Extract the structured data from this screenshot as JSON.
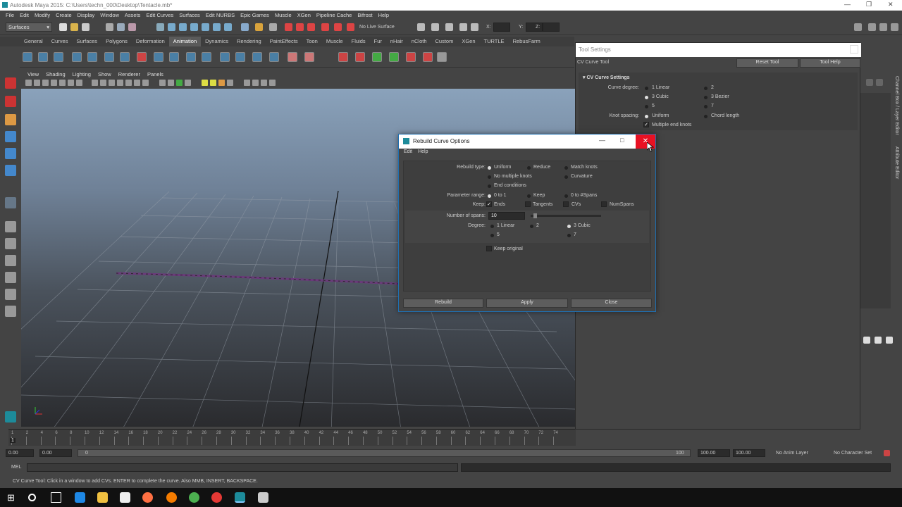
{
  "window": {
    "title": "Autodesk Maya 2015: C:\\Users\\techn_000\\Desktop\\Tentacle.mb*"
  },
  "menubar": [
    "File",
    "Edit",
    "Modify",
    "Create",
    "Display",
    "Window",
    "Assets",
    "Edit Curves",
    "Surfaces",
    "Edit NURBS",
    "Epic Games",
    "Muscle",
    "XGen",
    "Pipeline Cache",
    "Bifrost",
    "Help"
  ],
  "statusline": {
    "menuset": "Surfaces",
    "live_surface": "No Live Surface",
    "x_label": "X:",
    "y_label": "Y:",
    "z_label": "Z:"
  },
  "shelf": {
    "tabs": [
      "General",
      "Curves",
      "Surfaces",
      "Polygons",
      "Deformation",
      "Animation",
      "Dynamics",
      "Rendering",
      "PaintEffects",
      "Toon",
      "Muscle",
      "Fluids",
      "Fur",
      "nHair",
      "nCloth",
      "Custom",
      "XGen",
      "TURTLE",
      "RebusFarm"
    ],
    "active_tab": "Animation"
  },
  "viewport": {
    "menu": [
      "View",
      "Shading",
      "Lighting",
      "Show",
      "Renderer",
      "Panels"
    ]
  },
  "tool_settings": {
    "title": "Tool Settings",
    "tool_name": "CV Curve Tool",
    "reset_button": "Reset Tool",
    "help_button": "Tool Help",
    "section": "CV Curve Settings",
    "curve_degree_label": "Curve degree:",
    "curve_degree_options": [
      "1 Linear",
      "2",
      "3 Cubic",
      "3 Bezier",
      "5",
      "7"
    ],
    "curve_degree_selected": "3 Cubic",
    "knot_spacing_label": "Knot spacing:",
    "knot_spacing_options": [
      "Uniform",
      "Chord length"
    ],
    "knot_spacing_selected": "Uniform",
    "multiple_end_knots": "Multiple end knots",
    "multiple_end_knots_checked": true
  },
  "channel_box": {
    "tab1": "Channel Box / Layer Editor",
    "tab2": "Attribute Editor"
  },
  "dialog": {
    "title": "Rebuild Curve Options",
    "menu": [
      "Edit",
      "Help"
    ],
    "rebuild_type_label": "Rebuild type:",
    "rebuild_type_options": [
      "Uniform",
      "Reduce",
      "Match knots",
      "No multiple knots",
      "Curvature",
      "End conditions"
    ],
    "rebuild_type_selected": "Uniform",
    "parameter_range_label": "Parameter range:",
    "parameter_range_options": [
      "0 to 1",
      "Keep",
      "0 to #Spans"
    ],
    "parameter_range_selected": "0 to 1",
    "keep_label": "Keep:",
    "keep_options": [
      "Ends",
      "Tangents",
      "CVs",
      "NumSpans"
    ],
    "keep_ends_checked": true,
    "spans_label": "Number of spans:",
    "spans_value": "10",
    "degree_label": "Degree:",
    "degree_options": [
      "1 Linear",
      "2",
      "3 Cubic",
      "5",
      "7"
    ],
    "degree_selected": "3 Cubic",
    "keep_original": "Keep original",
    "buttons": [
      "Rebuild",
      "Apply",
      "Close"
    ]
  },
  "timeline": {
    "ticks": [
      "1",
      "2",
      "4",
      "6",
      "8",
      "10",
      "12",
      "14",
      "16",
      "18",
      "20",
      "22",
      "24",
      "26",
      "28",
      "30",
      "32",
      "34",
      "36",
      "38",
      "40",
      "42",
      "44",
      "46",
      "48",
      "50",
      "52",
      "54",
      "56",
      "58",
      "60",
      "62",
      "64",
      "66",
      "68",
      "70",
      "72",
      "74"
    ],
    "current_frame": "1"
  },
  "range": {
    "start": "0.00",
    "anim_start": "0.00",
    "range_start_label": "0",
    "range_end_label": "100",
    "anim_end": "100.00",
    "end": "100.00",
    "anim_layer": "No Anim Layer",
    "character_set": "No Character Set"
  },
  "command_line": {
    "label": "MEL"
  },
  "help_line": "CV Curve Tool: Click in a window to add CVs. ENTER to complete the curve. Also MMB, INSERT, BACKSPACE.",
  "colors": {
    "close_red": "#e81123",
    "maya_bg": "#444444",
    "curve": "#6a3a7a"
  }
}
